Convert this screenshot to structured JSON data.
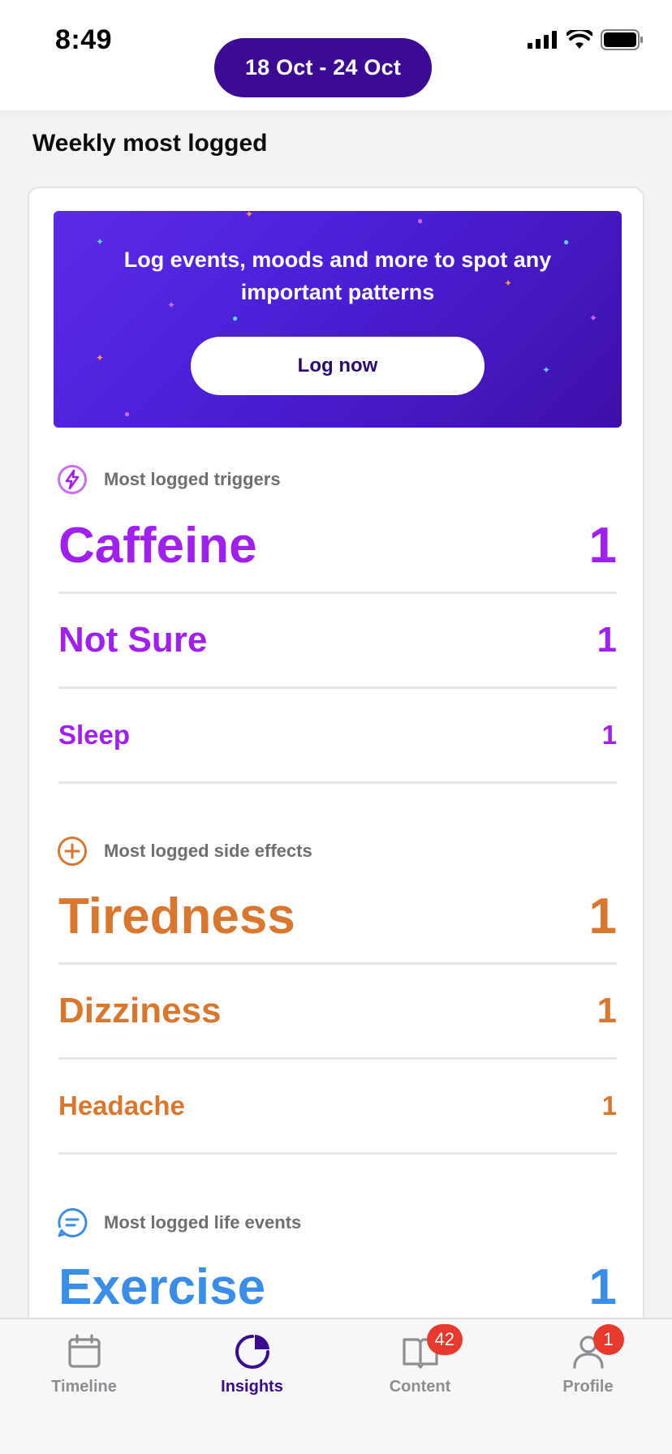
{
  "status_bar": {
    "time": "8:49"
  },
  "header": {
    "date_range": "18 Oct - 24 Oct"
  },
  "page": {
    "section_title": "Weekly most logged"
  },
  "banner": {
    "text": "Log events, moods and more to spot any important patterns",
    "button_label": "Log now"
  },
  "groups": {
    "triggers": {
      "label": "Most logged triggers",
      "items": [
        {
          "name": "Caffeine",
          "count": "1"
        },
        {
          "name": "Not Sure",
          "count": "1"
        },
        {
          "name": "Sleep",
          "count": "1"
        }
      ]
    },
    "side_effects": {
      "label": "Most logged side effects",
      "items": [
        {
          "name": "Tiredness",
          "count": "1"
        },
        {
          "name": "Dizziness",
          "count": "1"
        },
        {
          "name": "Headache",
          "count": "1"
        }
      ]
    },
    "life_events": {
      "label": "Most logged life events",
      "items": [
        {
          "name": "Exercise",
          "count": "1"
        }
      ]
    }
  },
  "tabbar": {
    "tabs": [
      {
        "label": "Timeline",
        "icon": "calendar-icon"
      },
      {
        "label": "Insights",
        "icon": "pie-chart-icon",
        "active": true
      },
      {
        "label": "Content",
        "icon": "book-icon",
        "badge": "42"
      },
      {
        "label": "Profile",
        "icon": "person-icon",
        "badge": "1"
      }
    ]
  },
  "colors": {
    "brand": "#3a0a93",
    "triggers": "#a020f0",
    "side_effects": "#d9772f",
    "life_events": "#3a8ee8",
    "badge": "#e8392f"
  }
}
